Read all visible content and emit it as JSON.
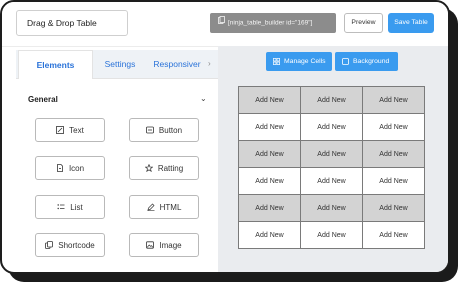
{
  "header": {
    "table_title": "Drag & Drop Table",
    "shortcode": "[ninja_table_builder id=\"169\"]",
    "preview_label": "Preview",
    "save_label": "Save Table"
  },
  "tabs": [
    {
      "label": "Elements",
      "active": true
    },
    {
      "label": "Settings",
      "active": false
    },
    {
      "label": "Responsiver",
      "active": false
    }
  ],
  "section": {
    "title": "General"
  },
  "elements": [
    {
      "label": "Text",
      "icon": "text-icon"
    },
    {
      "label": "Button",
      "icon": "button-icon"
    },
    {
      "label": "Icon",
      "icon": "file-icon"
    },
    {
      "label": "Ratting",
      "icon": "star-icon"
    },
    {
      "label": "List",
      "icon": "list-icon"
    },
    {
      "label": "HTML",
      "icon": "pen-icon"
    },
    {
      "label": "Shortcode",
      "icon": "copy-icon"
    },
    {
      "label": "Image",
      "icon": "image-icon"
    }
  ],
  "toolbar": {
    "manage_cells_label": "Manage Cells",
    "background_label": "Background"
  },
  "table_grid": {
    "cell_text": "Add New",
    "rows": [
      [
        "Add New",
        "Add New",
        "Add New"
      ],
      [
        "Add New",
        "Add New",
        "Add New"
      ],
      [
        "Add New",
        "Add New",
        "Add New"
      ],
      [
        "Add New",
        "Add New",
        "Add New"
      ],
      [
        "Add New",
        "Add New",
        "Add New"
      ],
      [
        "Add New",
        "Add New",
        "Add New"
      ]
    ]
  },
  "colors": {
    "accent": "#3a9bef",
    "gray_row": "#d3d3d3"
  }
}
